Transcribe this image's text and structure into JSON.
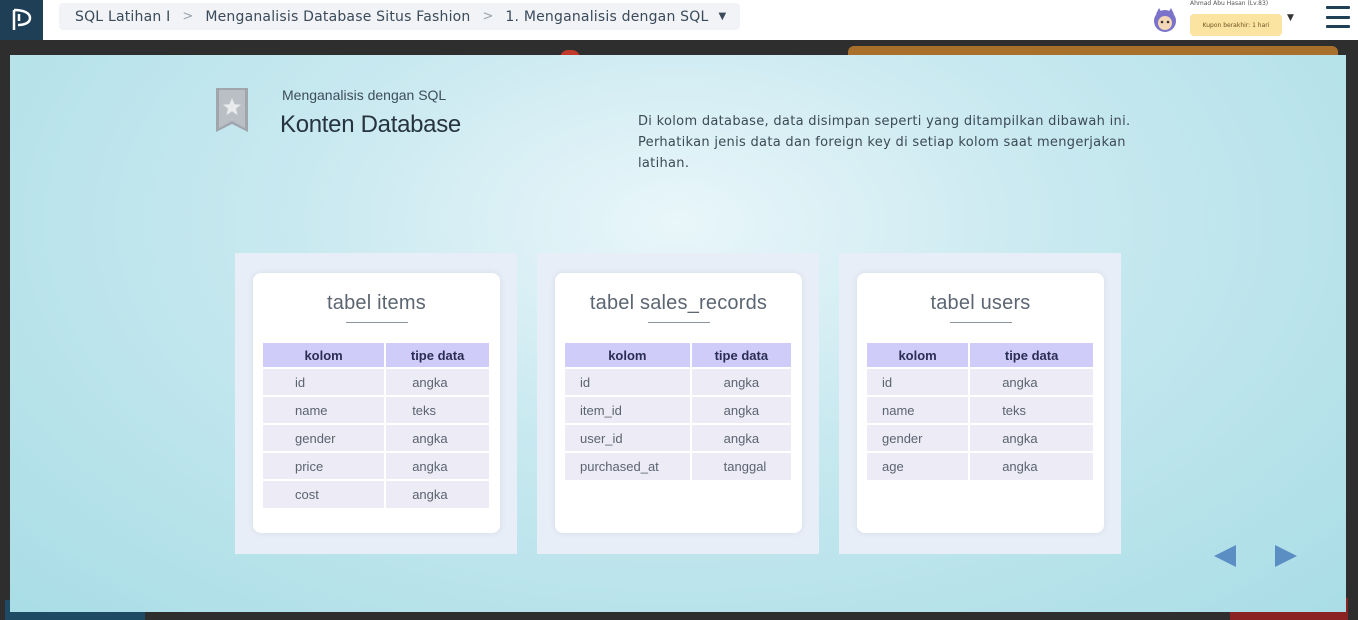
{
  "breadcrumb": {
    "course": "SQL Latihan I",
    "chapter": "Menganalisis Database Situs Fashion",
    "lesson": "1. Menganalisis dengan SQL"
  },
  "user": {
    "name": "Ahmad Abu Hasan (Lv.83)",
    "coupon": "Kupon berakhir: 1 hari"
  },
  "slide": {
    "subtitle": "Menganalisis dengan SQL",
    "title": "Konten Database",
    "description": "Di kolom database, data disimpan seperti yang ditampilkan dibawah ini. Perhatikan jenis data dan foreign key di setiap kolom saat mengerjakan latihan."
  },
  "tables": [
    {
      "title": "tabel items",
      "headers": [
        "kolom",
        "tipe data"
      ],
      "rows": [
        [
          "id",
          "angka"
        ],
        [
          "name",
          "teks"
        ],
        [
          "gender",
          "angka"
        ],
        [
          "price",
          "angka"
        ],
        [
          "cost",
          "angka"
        ]
      ]
    },
    {
      "title": "tabel sales_records",
      "headers": [
        "kolom",
        "tipe data"
      ],
      "rows": [
        [
          "id",
          "angka"
        ],
        [
          "item_id",
          "angka"
        ],
        [
          "user_id",
          "angka"
        ],
        [
          "purchased_at",
          "tanggal"
        ]
      ]
    },
    {
      "title": "tabel users",
      "headers": [
        "kolom",
        "tipe data"
      ],
      "rows": [
        [
          "id",
          "angka"
        ],
        [
          "name",
          "teks"
        ],
        [
          "gender",
          "angka"
        ],
        [
          "age",
          "angka"
        ]
      ]
    }
  ],
  "colors": {
    "header_bg": "#d0ccfa",
    "row_bg": "#ecebf6",
    "nav_arrow": "#5b8fc4",
    "logo_bg": "#1f3f57"
  },
  "icons": {
    "logo": "progate-logo-icon",
    "bookmark": "bookmark-star-icon",
    "prev": "prev-arrow-icon",
    "next": "next-arrow-icon",
    "menu": "hamburger-menu-icon"
  }
}
